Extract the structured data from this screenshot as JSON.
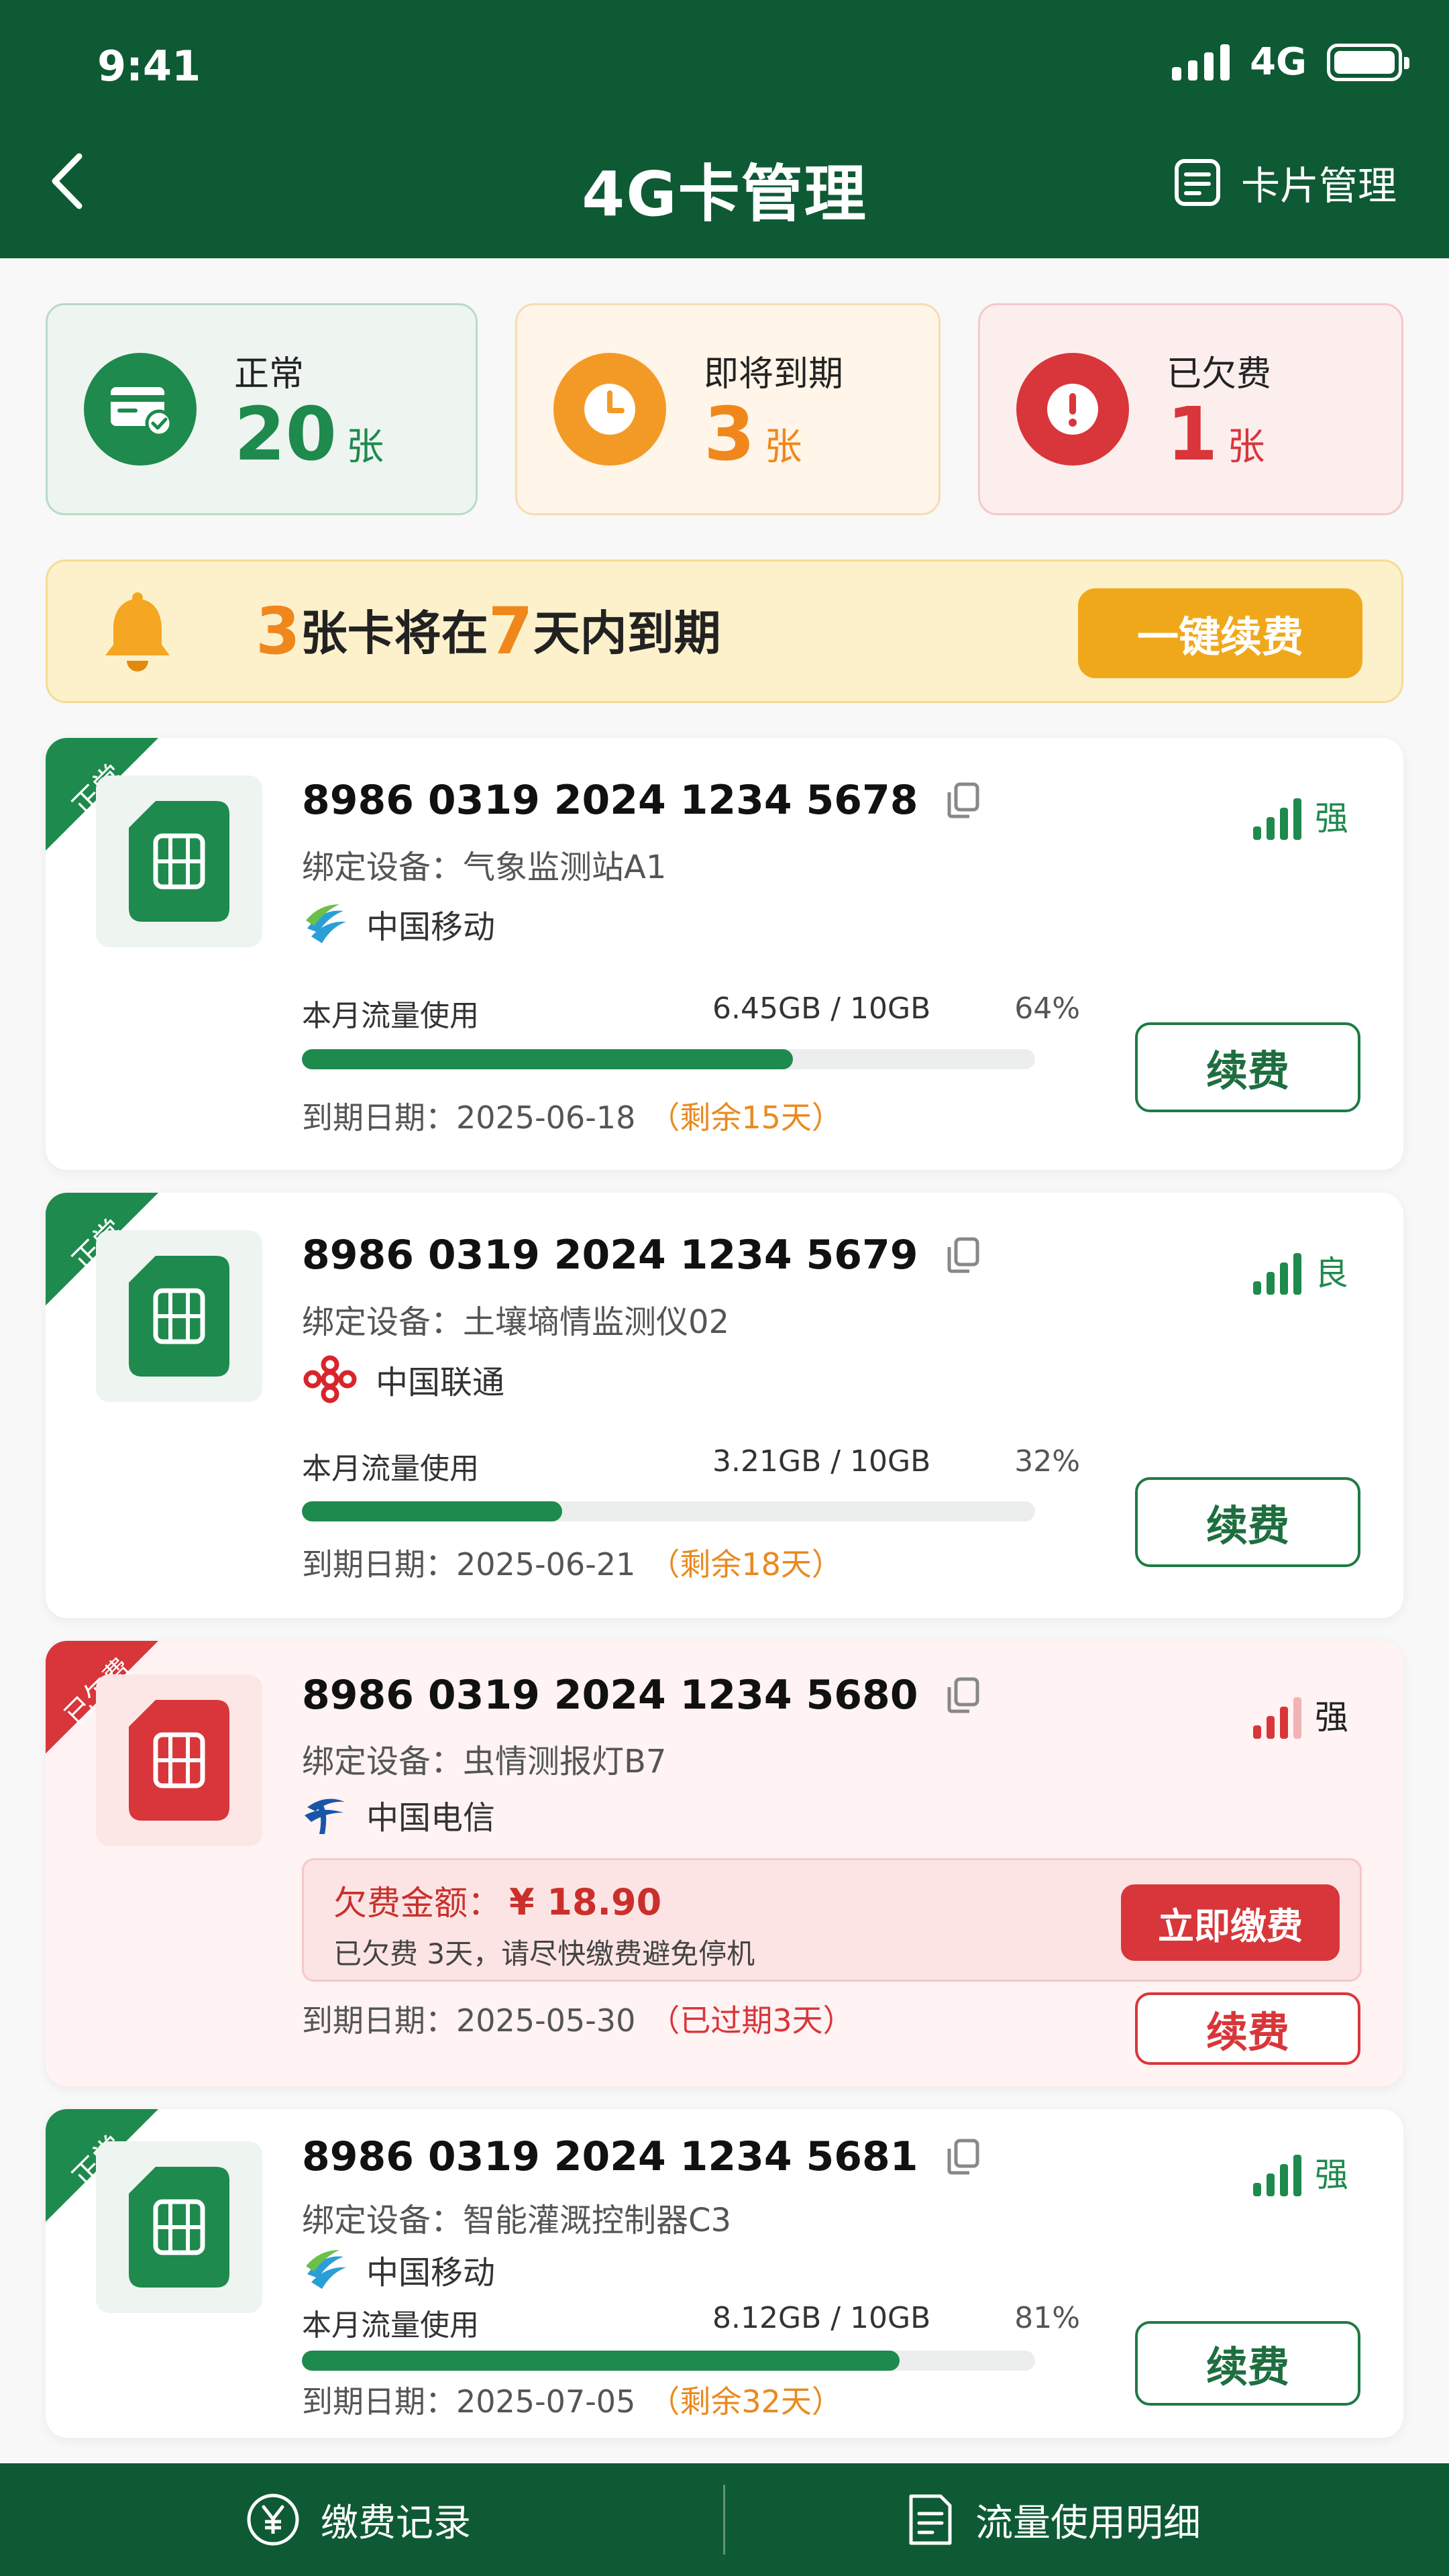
{
  "status": {
    "time": "9:41",
    "network": "4G"
  },
  "header": {
    "title": "4G卡管理",
    "right_action": "卡片管理"
  },
  "stats": [
    {
      "label": "正常",
      "count": "20",
      "unit": "张",
      "color": "#1e8a4d"
    },
    {
      "label": "即将到期",
      "count": "3",
      "unit": "张",
      "color": "#f0871d"
    },
    {
      "label": "已欠费",
      "count": "1",
      "unit": "张",
      "color": "#d8363a"
    }
  ],
  "alert": {
    "count": "3",
    "text1": "张卡将在",
    "days": "7",
    "text2": "天内到期",
    "button": "一键续费"
  },
  "cards": [
    {
      "status": "正常",
      "number": "8986 0319 2024 1234 5678",
      "device": "绑定设备：气象监测站A1",
      "carrier": "中国移动",
      "signal": "强",
      "usage_label": "本月流量使用",
      "usage": "6.45GB / 10GB",
      "percent": "64%",
      "usage_fraction": 0.67,
      "expiry": "到期日期：2025-06-18",
      "remaining": "（剩余15天）",
      "renew": "续费"
    },
    {
      "status": "正常",
      "number": "8986 0319 2024 1234 5679",
      "device": "绑定设备：土壤墒情监测仪02",
      "carrier": "中国联通",
      "signal": "良",
      "usage_label": "本月流量使用",
      "usage": "3.21GB / 10GB",
      "percent": "32%",
      "usage_fraction": 0.355,
      "expiry": "到期日期：2025-06-21",
      "remaining": "（剩余18天）",
      "renew": "续费"
    },
    {
      "status": "已欠费",
      "number": "8986 0319 2024 1234 5680",
      "device": "绑定设备：虫情测报灯B7",
      "carrier": "中国电信",
      "signal": "强",
      "debt_label": "欠费金额：",
      "debt_amount": "¥ 18.90",
      "debt_note": "已欠费 3天，请尽快缴费避免停机",
      "pay_button": "立即缴费",
      "expiry": "到期日期：2025-05-30",
      "remaining": "（已过期3天）",
      "renew": "续费"
    },
    {
      "status": "正常",
      "number": "8986 0319 2024 1234 5681",
      "device": "绑定设备：智能灌溉控制器C3",
      "carrier": "中国移动",
      "signal": "强",
      "usage_label": "本月流量使用",
      "usage": "8.12GB / 10GB",
      "percent": "81%",
      "usage_fraction": 0.815,
      "expiry": "到期日期：2025-07-05",
      "remaining": "（剩余32天）",
      "renew": "续费"
    }
  ],
  "bottom_nav": [
    {
      "label": "缴费记录",
      "icon": "yen-circle-icon"
    },
    {
      "label": "流量使用明细",
      "icon": "document-list-icon"
    }
  ]
}
